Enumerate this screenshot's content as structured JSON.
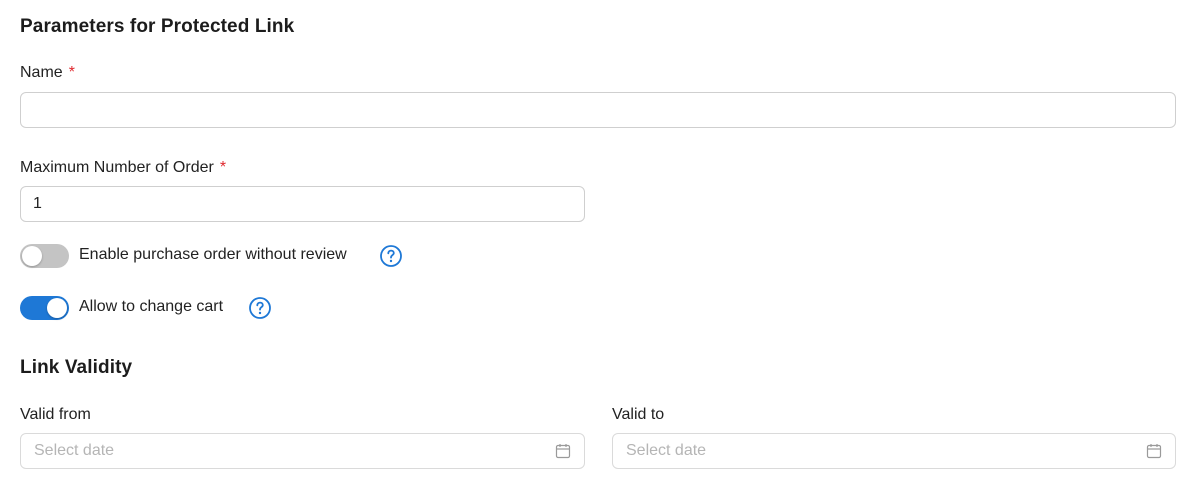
{
  "form": {
    "title": "Parameters for Protected Link",
    "name": {
      "label": "Name",
      "required_mark": "*",
      "value": ""
    },
    "max_orders": {
      "label": "Maximum Number of Order",
      "required_mark": "*",
      "value": "1"
    },
    "toggles": [
      {
        "label": "Enable purchase order without review",
        "enabled": false,
        "help_icon": "question-circle-icon"
      },
      {
        "label": "Allow to change cart",
        "enabled": true,
        "help_icon": "question-circle-icon"
      }
    ]
  },
  "validity": {
    "title": "Link Validity",
    "valid_from": {
      "label": "Valid from",
      "placeholder": "Select date",
      "icon": "calendar-icon"
    },
    "valid_to": {
      "label": "Valid to",
      "placeholder": "Select date",
      "icon": "calendar-icon"
    }
  },
  "colors": {
    "accent": "#1e78d6",
    "toggle_off": "#c4c4c4",
    "required": "#e0282e"
  }
}
